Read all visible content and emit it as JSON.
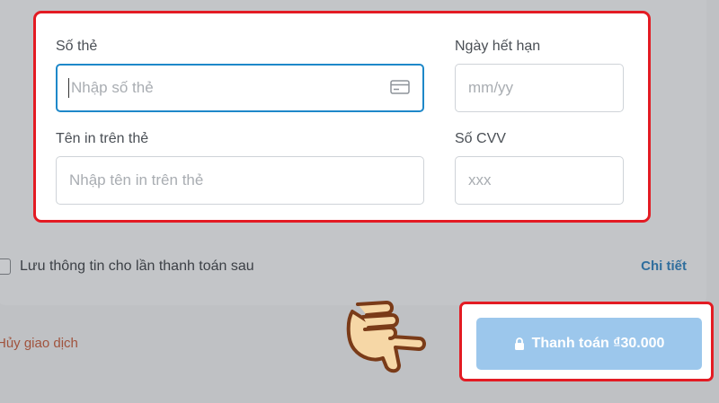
{
  "card_form": {
    "card_number_label": "Số thẻ",
    "card_number_placeholder": "Nhập số thẻ",
    "expiry_label": "Ngày hết hạn",
    "expiry_placeholder": "mm/yy",
    "name_label": "Tên in trên thẻ",
    "name_placeholder": "Nhập tên in trên thẻ",
    "cvv_label": "Số CVV",
    "cvv_placeholder": "xxx"
  },
  "save_option": {
    "label": "Lưu thông tin cho lần thanh toán sau",
    "checked": false,
    "details_link": "Chi tiết"
  },
  "actions": {
    "cancel_label": "Hủy giao dịch",
    "pay_label": "Thanh toán ₫30.000",
    "pay_icon": "lock-icon"
  },
  "colors": {
    "highlight": "#e31b23",
    "focus": "#1e88c9",
    "pay_button": "#9cc7ec",
    "link": "#2f6e9d"
  }
}
